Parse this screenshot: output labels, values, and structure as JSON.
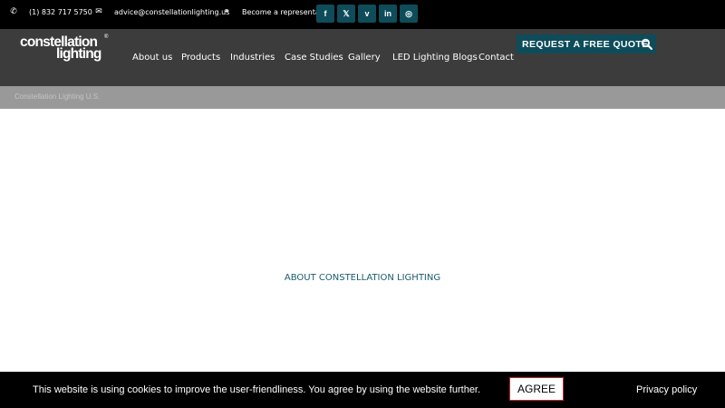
{
  "topbar": {
    "phone": "(1) 832 717 5750",
    "email": "advice@constellationlighting.us",
    "representative": "Become a representative",
    "phone_icon": "phone-icon",
    "email_icon": "envelope-icon",
    "representative_icon": "handshake-icon"
  },
  "social": [
    {
      "name": "facebook-icon",
      "glyph": "f"
    },
    {
      "name": "x-icon",
      "glyph": "𝕏"
    },
    {
      "name": "vimeo-icon",
      "glyph": "v"
    },
    {
      "name": "linkedin-icon",
      "glyph": "in"
    },
    {
      "name": "instagram-icon",
      "glyph": "◎"
    }
  ],
  "logo": {
    "line1": "constellation",
    "line2": "lighting",
    "mark": "®"
  },
  "nav": {
    "about": "About us",
    "products": "Products",
    "industries": "Industries",
    "case_studies": "Case Studies",
    "gallery": "Gallery",
    "blogs": "LED Lighting Blogs",
    "contact": "Contact"
  },
  "cta": {
    "label": "REQUEST A FREE QUOTE",
    "icon": "search-icon"
  },
  "breadcrumb": "Constellation Lighting U.S.",
  "main": {
    "heading": "ABOUT CONSTELLATION LIGHTING"
  },
  "cookie": {
    "text": "This website is using cookies to improve the user-friendliness. You agree by using the website further.",
    "agree_label": "AGREE",
    "privacy_label": "Privacy policy"
  },
  "colors": {
    "teal": "#0e4c5a",
    "header": "#3c3c3c",
    "crumb": "#999999",
    "link": "#1a5c6c",
    "agree_border": "#c0282e"
  }
}
